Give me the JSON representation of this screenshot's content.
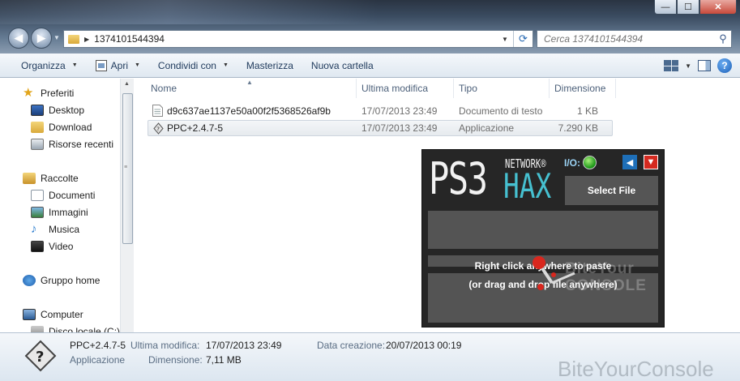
{
  "window": {
    "min_glyph": "—",
    "max_glyph": "☐",
    "close_glyph": "✕"
  },
  "address": {
    "path": "1374101544394",
    "search_placeholder": "Cerca 1374101544394"
  },
  "toolbar": {
    "organizza": "Organizza",
    "apri": "Apri",
    "condividi": "Condividi con",
    "masterizza": "Masterizza",
    "nuova_cartella": "Nuova cartella"
  },
  "nav": {
    "favorites_header": "Preferiti",
    "desktop": "Desktop",
    "download": "Download",
    "risorse": "Risorse recenti",
    "libraries_header": "Raccolte",
    "documenti": "Documenti",
    "immagini": "Immagini",
    "musica": "Musica",
    "video": "Video",
    "homegroup": "Gruppo home",
    "computer": "Computer",
    "disk": "Disco locale (C:)"
  },
  "columns": {
    "name": "Nome",
    "modified": "Ultima modifica",
    "type": "Tipo",
    "size": "Dimensione"
  },
  "files": [
    {
      "name": "d9c637ae1137e50a00f2f5368526af9b",
      "modified": "17/07/2013 23:49",
      "type": "Documento di testo",
      "size": "1 KB"
    },
    {
      "name": "PPC+2.4.7-5",
      "modified": "17/07/2013 23:49",
      "type": "Applicazione",
      "size": "7.290 KB"
    }
  ],
  "app": {
    "logo_main": "PS3",
    "logo_network": "NETWORK®",
    "logo_hax": "HAX",
    "io_label": "I/O:",
    "select_file": "Select File",
    "drop_line1": "Right click anywhere to paste",
    "drop_line2": "(or drag and drop file anywhere)",
    "watermark1": "BiteYour",
    "watermark2": "CONSOLE",
    "accent": "#46c0d0"
  },
  "details": {
    "name": "PPC+2.4.7-5",
    "type": "Applicazione",
    "modified_label": "Ultima modifica:",
    "modified_value": "17/07/2013 23:49",
    "size_label": "Dimensione:",
    "size_value": "7,11 MB",
    "created_label": "Data creazione:",
    "created_value": "20/07/2013 00:19"
  },
  "watermark": "BiteYourConsole"
}
